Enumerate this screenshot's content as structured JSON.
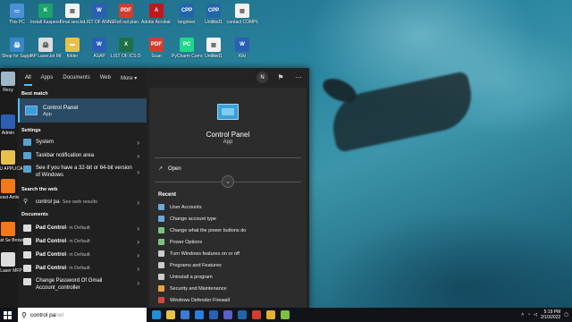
{
  "desktop_icons": [
    {
      "label": "This PC",
      "color": "#4a90d9",
      "glyph": "▭"
    },
    {
      "label": "Install Kaspersk...",
      "color": "#1aa36b",
      "glyph": "K"
    },
    {
      "label": "Final seccko",
      "color": "#f2f2f2",
      "glyph": "▤"
    },
    {
      "label": "LIST OF ANNEX",
      "color": "#2b5fb4",
      "glyph": "W"
    },
    {
      "label": "Roll out plan",
      "color": "#d23d2f",
      "glyph": "PDF"
    },
    {
      "label": "Adobe Acrobat DC",
      "color": "#c4161c",
      "glyph": "A"
    },
    {
      "label": "beginner",
      "color": "#2266aa",
      "glyph": "CPP"
    },
    {
      "label": "Untitled1",
      "color": "#2266aa",
      "glyph": "CPP"
    },
    {
      "label": "contact COMPENS...",
      "color": "#f2f2f2",
      "glyph": "▤"
    },
    {
      "label": "Shop for Supplies -...",
      "color": "#3a86c8",
      "glyph": "🖨"
    },
    {
      "label": "HP LaserJet MFP M129...",
      "color": "#dddddd",
      "glyph": "🖨"
    },
    {
      "label": "folder",
      "color": "#e8c04a",
      "glyph": "▬"
    },
    {
      "label": "ASAP",
      "color": "#2b5fb4",
      "glyph": "W"
    },
    {
      "label": "LIST OF ICS DISTRIBUTE...",
      "color": "#1e7145",
      "glyph": "X"
    },
    {
      "label": "Scan",
      "color": "#d23d2f",
      "glyph": "PDF"
    },
    {
      "label": "PyCharm Commun...",
      "color": "#21d789",
      "glyph": "PC"
    },
    {
      "label": "Untitled1",
      "color": "#f2f2f2",
      "glyph": "▤"
    },
    {
      "label": "Kiki",
      "color": "#2b5fb4",
      "glyph": "W"
    }
  ],
  "side_icons": [
    {
      "label": "Recy",
      "color": "#9fb8c8"
    },
    {
      "label": "Admin",
      "color": "#2b5fb4"
    },
    {
      "label": "EDU APPLICA",
      "color": "#e8c04a"
    },
    {
      "label": "Avast Antiv",
      "color": "#f07a1a"
    },
    {
      "label": "Avast Se Brows",
      "color": "#f07a1a"
    },
    {
      "label": "HP Laser MFP M12",
      "color": "#dddddd"
    }
  ],
  "start_menu": {
    "tabs": [
      "All",
      "Apps",
      "Documents",
      "Web",
      "More ▾"
    ],
    "avatar_letter": "N",
    "best_match_heading": "Best match",
    "best_match": {
      "title": "Control Panel",
      "subtitle": "App"
    },
    "settings_heading": "Settings",
    "settings": [
      {
        "label": "System"
      },
      {
        "label": "Taskbar notification area"
      },
      {
        "label": "See if you have a 32-bit or 64-bit version of Windows"
      }
    ],
    "web_heading": "Search the web",
    "web_item": {
      "query": "control pa",
      "suffix": " - See web results"
    },
    "documents_heading": "Documents",
    "documents": [
      {
        "name": "Pad Control",
        "location": " - in Default"
      },
      {
        "name": "Pad Control",
        "location": " - in Default"
      },
      {
        "name": "Pad Control",
        "location": " - in Default"
      },
      {
        "name": "Pad Control",
        "location": " - in Default"
      },
      {
        "name": "Change Password Of Gmail Account_controller",
        "location": ""
      }
    ],
    "detail": {
      "title": "Control Panel",
      "subtitle": "App",
      "open_label": "Open",
      "recent_heading": "Recent",
      "recent": [
        {
          "label": "User Accounts",
          "color": "#6fa8dc"
        },
        {
          "label": "Change account type",
          "color": "#6fa8dc"
        },
        {
          "label": "Change what the power buttons do",
          "color": "#7bc47f"
        },
        {
          "label": "Power Options",
          "color": "#7bc47f"
        },
        {
          "label": "Turn Windows features on or off",
          "color": "#cccccc"
        },
        {
          "label": "Programs and Features",
          "color": "#cccccc"
        },
        {
          "label": "Uninstall a program",
          "color": "#cccccc"
        },
        {
          "label": "Security and Maintenance",
          "color": "#e8a33d"
        },
        {
          "label": "Windows Defender Firewall",
          "color": "#d04a3a"
        }
      ]
    }
  },
  "taskbar": {
    "search_value": "control pa",
    "search_placeholder_suffix": "nel",
    "apps": [
      {
        "name": "edge",
        "color": "#1f8fd6"
      },
      {
        "name": "file-explorer",
        "color": "#e8c04a"
      },
      {
        "name": "store",
        "color": "#3a7bd5"
      },
      {
        "name": "mail",
        "color": "#2b7de0"
      },
      {
        "name": "word",
        "color": "#2b5fb4"
      },
      {
        "name": "teams",
        "color": "#5b5fc7"
      },
      {
        "name": "cpp-app",
        "color": "#2266aa"
      },
      {
        "name": "red-app",
        "color": "#d23d2f"
      },
      {
        "name": "chrome",
        "color": "#e4b12c"
      },
      {
        "name": "green-app",
        "color": "#7ac143"
      }
    ],
    "time": "5:19 PM",
    "date": "2/10/2022"
  }
}
